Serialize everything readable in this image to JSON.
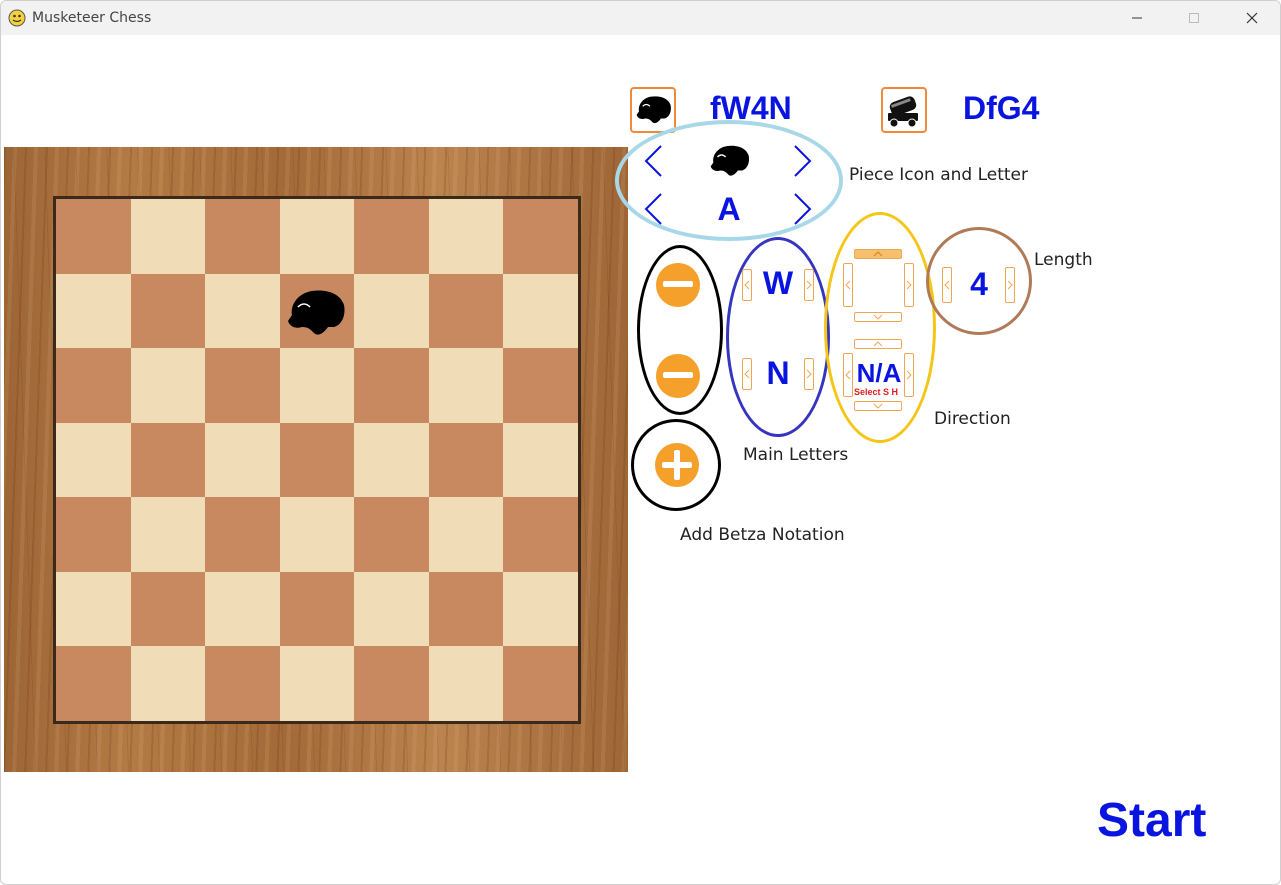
{
  "window": {
    "title": "Musketeer Chess",
    "controls": {
      "minimize": "minimize-icon",
      "maximize": "maximize-icon",
      "close": "close-icon"
    }
  },
  "header": {
    "piece1": {
      "icon": "musketeer-piece-icon",
      "notation": "fW4N"
    },
    "piece2": {
      "icon": "cannon-piece-icon",
      "notation": "DfG4"
    }
  },
  "piece_selector": {
    "icon": "musketeer-piece-icon",
    "letter": "A",
    "label": "Piece Icon and Letter"
  },
  "notation_rows": {
    "remove_buttons": [
      "minus-icon",
      "minus-icon"
    ],
    "add_button": "plus-icon",
    "add_label": "Add Betza Notation"
  },
  "main_letters": {
    "letters": [
      "W",
      "N"
    ],
    "label": "Main Letters"
  },
  "direction": {
    "row1_value": "",
    "row2_value": "N/A",
    "row2_hint": "Select S H",
    "label": "Direction"
  },
  "length": {
    "value": "4",
    "label": "Length"
  },
  "board": {
    "rows": 7,
    "cols": 7
  },
  "start_label": "Start",
  "colors": {
    "accent_blue": "#0a14e0",
    "orange": "#f5a02a",
    "board_dark": "#c98960",
    "board_light": "#f1dcb8",
    "ellipse_light_blue": "#a8d8e8",
    "ellipse_black": "#000000",
    "ellipse_blue": "#3535c0",
    "ellipse_yellow": "#f5c518",
    "ellipse_brown": "#b07a58"
  }
}
